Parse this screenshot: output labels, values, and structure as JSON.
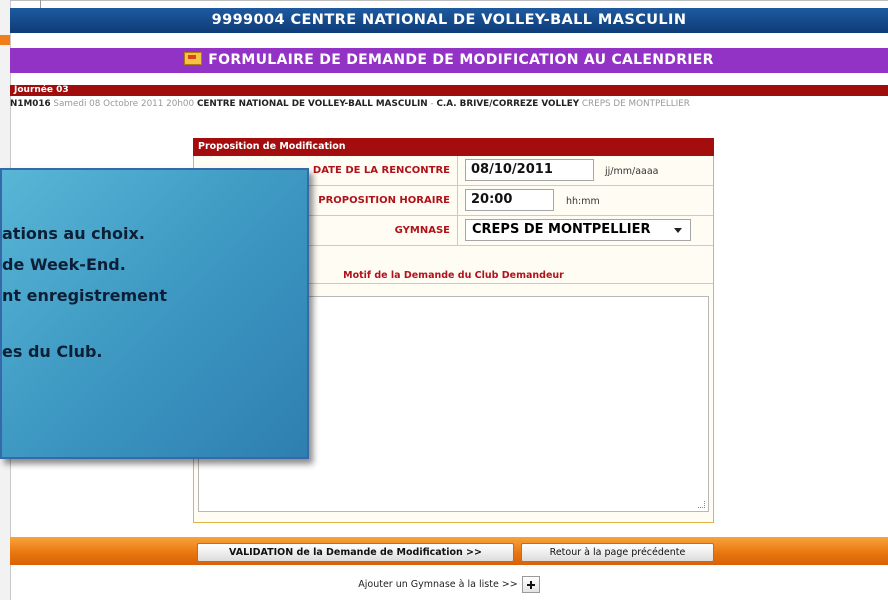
{
  "header": {
    "title": "9999004 CENTRE NATIONAL DE VOLLEY-BALL MASCULIN",
    "subtitle": "FORMULAIRE DE DEMANDE DE MODIFICATION AU CALENDRIER",
    "subtitle_icon": "envelope-icon"
  },
  "match": {
    "journee": "Journée 03",
    "code": "N1M016",
    "date_text": "Samedi 08 Octobre 2011 20h00",
    "home": "CENTRE NATIONAL DE VOLLEY-BALL MASCULIN",
    "separator": "-",
    "away": "C.A. BRIVE/CORREZE VOLLEY",
    "venue": "CREPS DE MONTPELLIER"
  },
  "form": {
    "title": "Proposition de Modification",
    "date_label": "DATE DE LA RENCONTRE",
    "date_value": "08/10/2011",
    "date_format": "jj/mm/aaaa",
    "time_label": "PROPOSITION HORAIRE",
    "time_value": "20:00",
    "time_format": "hh:mm",
    "gym_label": "GYMNASE",
    "gym_value": "CREPS DE MONTPELLIER",
    "motif_label": "Motif de la Demande du Club Demandeur",
    "motif_value": ""
  },
  "callout": {
    "line1": "ations au choix.",
    "line2": "de Week-End.",
    "line3": "nt  enregistrement",
    "line4": "es du Club."
  },
  "actions": {
    "validate": "VALIDATION de la Demande de Modification >>",
    "back": "Retour à la page précédente",
    "add_gym": "Ajouter un Gymnase à la liste >>"
  }
}
